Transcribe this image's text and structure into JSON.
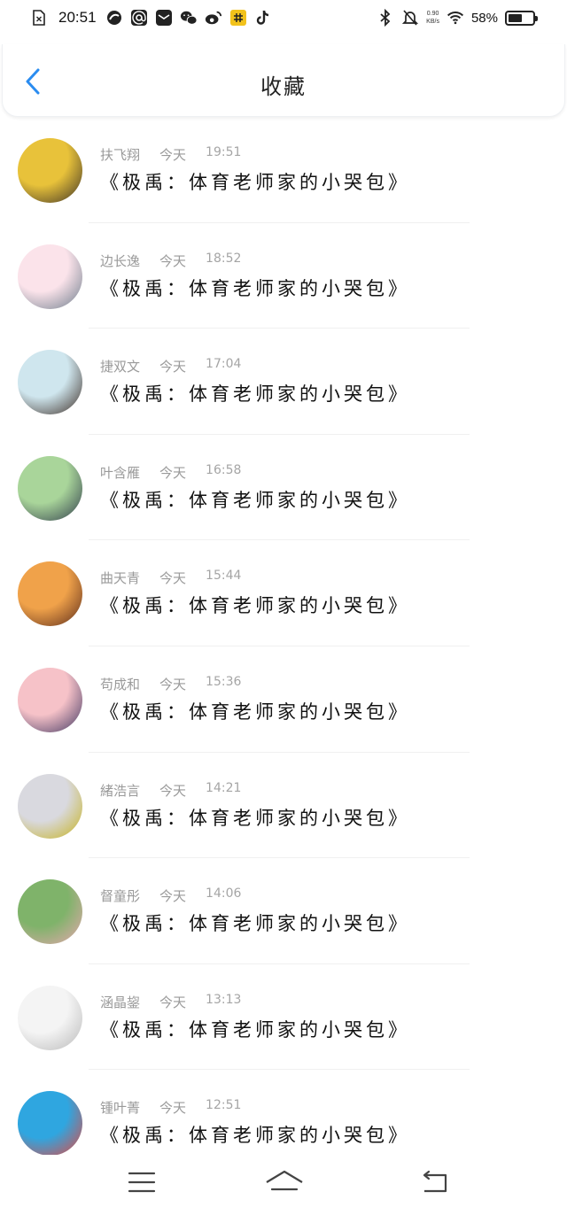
{
  "status_bar": {
    "time": "20:51",
    "net_speed_value": "0.90",
    "net_speed_unit": "KB/s",
    "battery_text": "58%",
    "battery_level": 0.58
  },
  "header": {
    "title": "收藏"
  },
  "favorites": [
    {
      "name": "扶飞翔",
      "day": "今天",
      "time": "19:51",
      "title": "《极禹：体育老师家的小哭包》",
      "avatar_colors": [
        "#e8c23a",
        "#3b3026"
      ]
    },
    {
      "name": "边长逸",
      "day": "今天",
      "time": "18:52",
      "title": "《极禹：体育老师家的小哭包》",
      "avatar_colors": [
        "#fbe3ea",
        "#6b7b8a"
      ]
    },
    {
      "name": "捷双文",
      "day": "今天",
      "time": "17:04",
      "title": "《极禹：体育老师家的小哭包》",
      "avatar_colors": [
        "#cfe6ee",
        "#3a2a22"
      ]
    },
    {
      "name": "叶含雁",
      "day": "今天",
      "time": "16:58",
      "title": "《极禹：体育老师家的小哭包》",
      "avatar_colors": [
        "#a9d59a",
        "#2e3a4a"
      ]
    },
    {
      "name": "曲天青",
      "day": "今天",
      "time": "15:44",
      "title": "《极禹：体育老师家的小哭包》",
      "avatar_colors": [
        "#f0a24a",
        "#5a2a1a"
      ]
    },
    {
      "name": "苟成和",
      "day": "今天",
      "time": "15:36",
      "title": "《极禹：体育老师家的小哭包》",
      "avatar_colors": [
        "#f6c2c8",
        "#3e3560"
      ]
    },
    {
      "name": "緒浩言",
      "day": "今天",
      "time": "14:21",
      "title": "《极禹：体育老师家的小哭包》",
      "avatar_colors": [
        "#d9d9df",
        "#c6b21c"
      ]
    },
    {
      "name": "督童彤",
      "day": "今天",
      "time": "14:06",
      "title": "《极禹：体育老师家的小哭包》",
      "avatar_colors": [
        "#7fb36a",
        "#e9a7b0"
      ]
    },
    {
      "name": "涵晶鋆",
      "day": "今天",
      "time": "13:13",
      "title": "《极禹：体育老师家的小哭包》",
      "avatar_colors": [
        "#f4f4f4",
        "#b8b8b8"
      ]
    },
    {
      "name": "锺叶菁",
      "day": "今天",
      "time": "12:51",
      "title": "《极禹：体育老师家的小哭包》",
      "avatar_colors": [
        "#2fa6e0",
        "#e8453c"
      ]
    }
  ],
  "colors": {
    "accent": "#2a8cf0",
    "text": "#111111",
    "meta": "#9a9a9a"
  },
  "icons": {
    "back": "chevron-left-icon",
    "menu": "menu-icon",
    "home": "home-icon",
    "return": "return-icon"
  }
}
